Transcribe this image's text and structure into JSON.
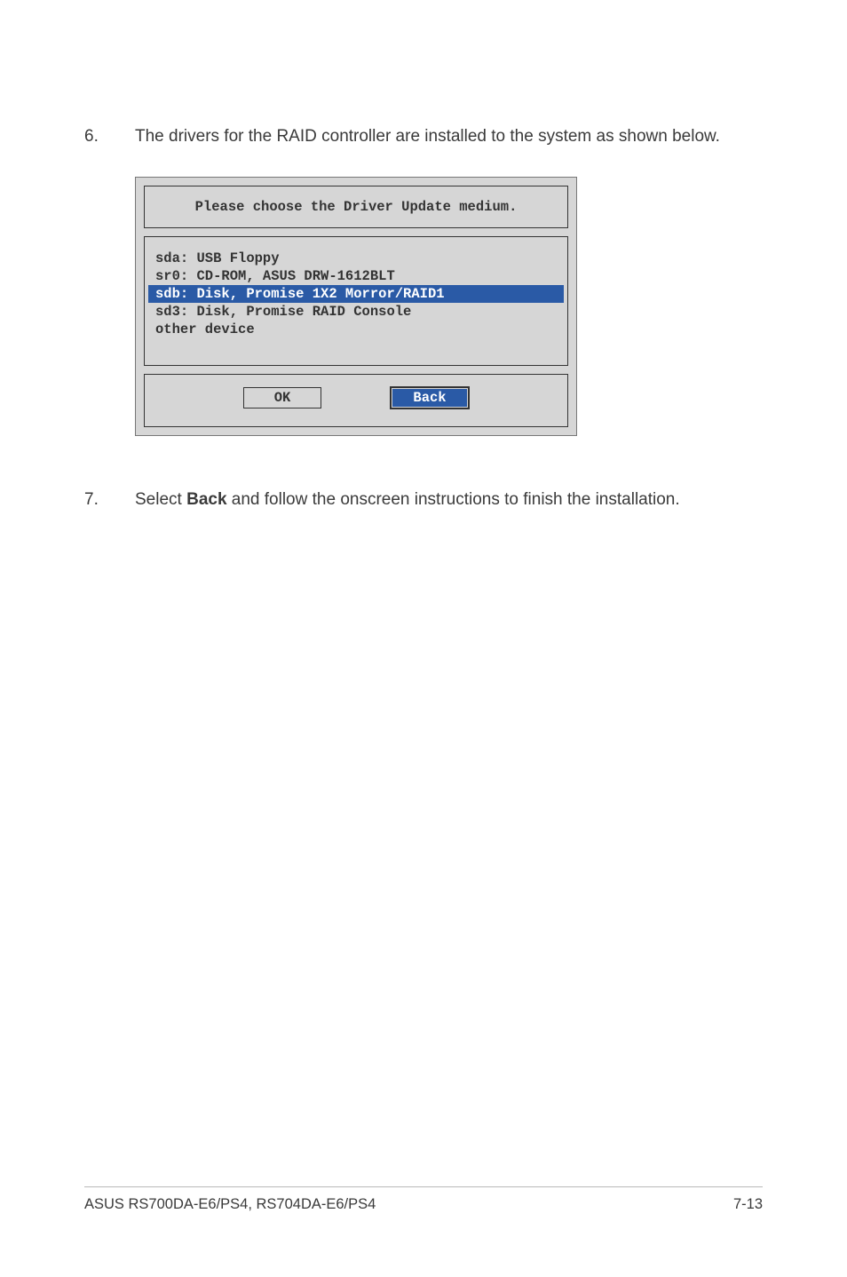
{
  "step6": {
    "num": "6.",
    "text": "The drivers for the RAID controller are installed to the system as shown below."
  },
  "dialog": {
    "title": "Please choose the Driver Update medium.",
    "items": {
      "i0": "sda: USB Floppy",
      "i1": "sr0: CD-ROM, ASUS DRW-1612BLT",
      "i2": "sdb: Disk, Promise 1X2 Morror/RAID1",
      "i3": "sd3: Disk, Promise RAID Console",
      "i4": "other device"
    },
    "buttons": {
      "ok": "OK",
      "back": "Back"
    }
  },
  "step7": {
    "num": "7.",
    "text_prefix": "Select ",
    "bold": "Back",
    "text_suffix": " and follow the onscreen instructions to finish the installation."
  },
  "footer": {
    "left": "ASUS RS700DA-E6/PS4, RS704DA-E6/PS4",
    "right": "7-13"
  }
}
